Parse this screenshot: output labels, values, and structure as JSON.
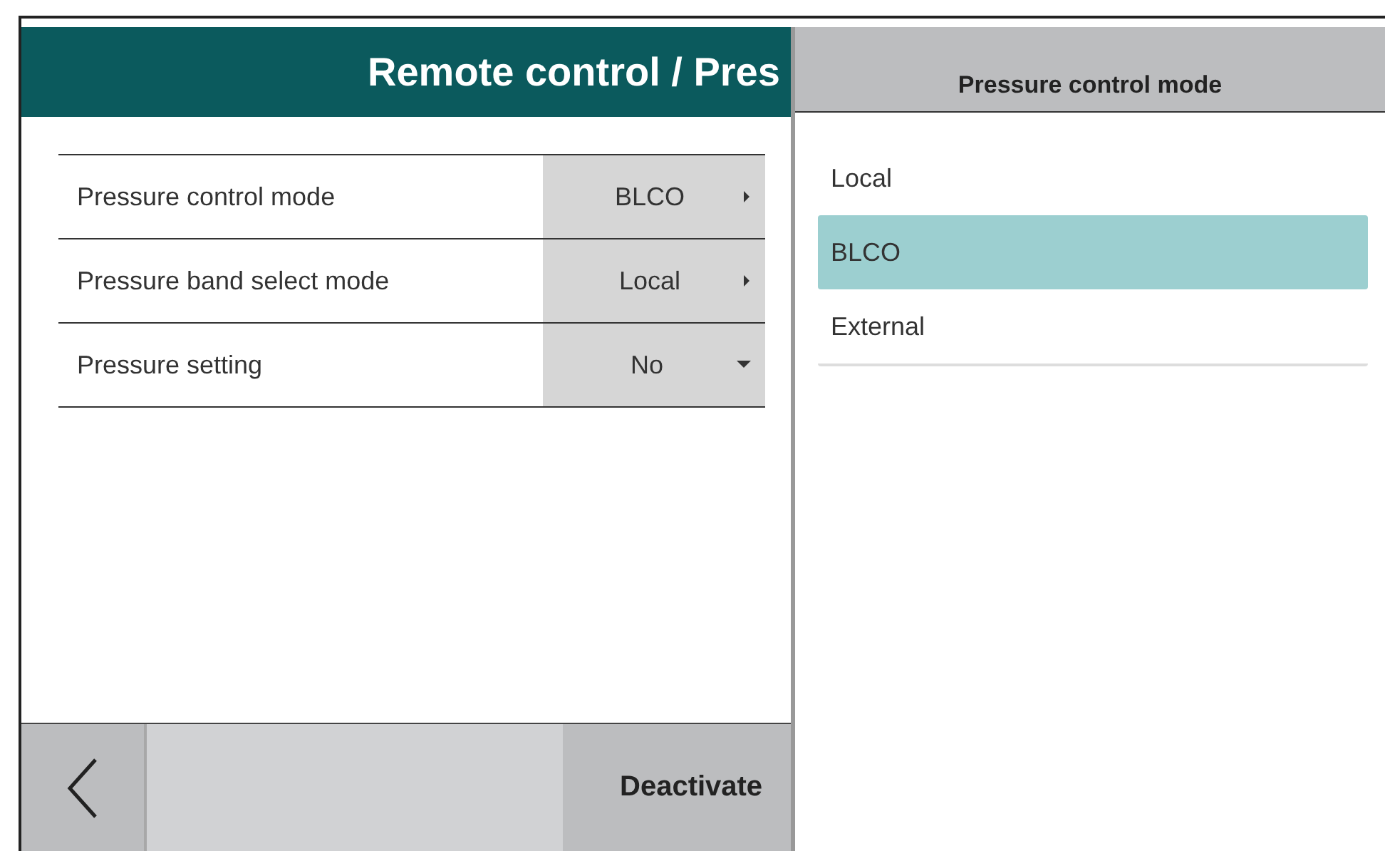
{
  "header": {
    "title": "Remote control / Pres"
  },
  "settings": [
    {
      "label": "Pressure control mode",
      "value": "BLCO",
      "kind": "submenu"
    },
    {
      "label": "Pressure band select mode",
      "value": "Local",
      "kind": "submenu"
    },
    {
      "label": "Pressure setting",
      "value": "No",
      "kind": "dropdown"
    }
  ],
  "footer": {
    "deactivate": "Deactivate"
  },
  "picker": {
    "title": "Pressure control mode",
    "options": [
      {
        "label": "Local",
        "selected": false
      },
      {
        "label": "BLCO",
        "selected": true
      },
      {
        "label": "External",
        "selected": false
      }
    ]
  }
}
